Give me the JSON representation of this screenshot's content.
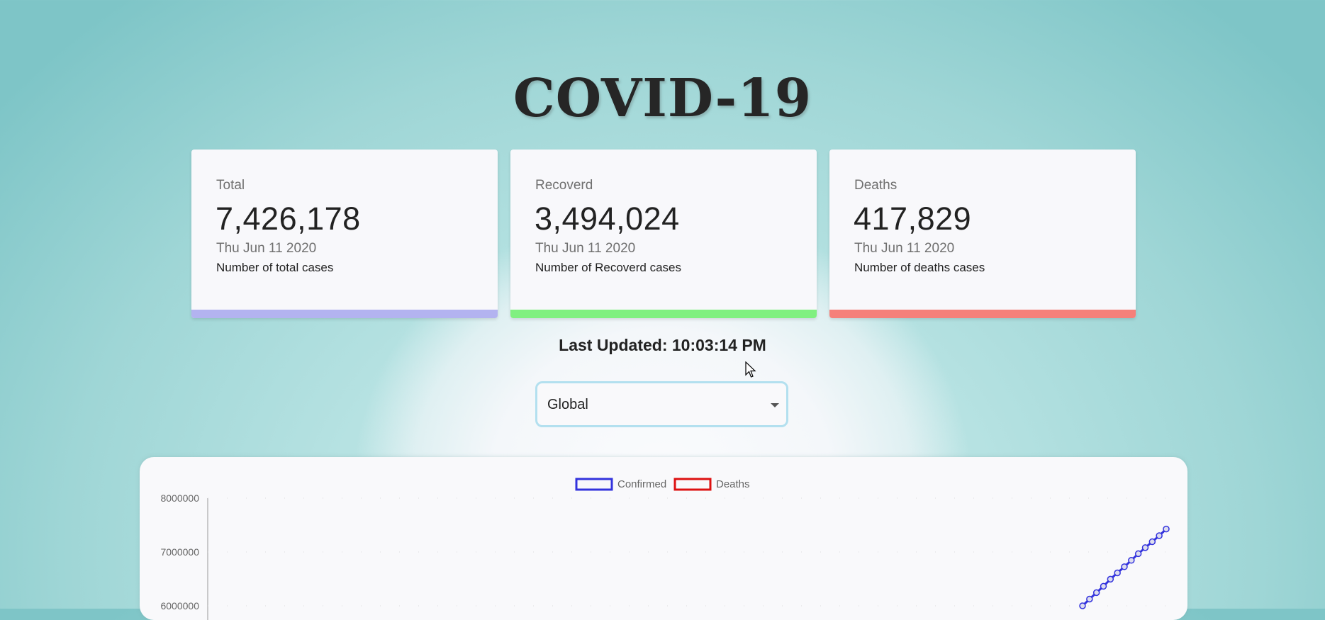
{
  "app": {
    "title": "COVID-19"
  },
  "cards": [
    {
      "label": "Total",
      "value": "7,426,178",
      "date": "Thu Jun 11 2020",
      "desc": "Number of total cases",
      "color": "#b3b3f0"
    },
    {
      "label": "Recoverd",
      "value": "3,494,024",
      "date": "Thu Jun 11 2020",
      "desc": "Number of Recoverd cases",
      "color": "#80f080"
    },
    {
      "label": "Deaths",
      "value": "417,829",
      "date": "Thu Jun 11 2020",
      "desc": "Number of deaths cases",
      "color": "#f5807a"
    }
  ],
  "last_updated": "Last Updated: 10:03:14 PM",
  "country_select": {
    "value": "Global"
  },
  "chart_data": {
    "type": "line",
    "legend": [
      {
        "name": "Confirmed",
        "color": "#3333dd"
      },
      {
        "name": "Deaths",
        "color": "#dd1111"
      }
    ],
    "y_ticks": [
      "8000000",
      "7000000",
      "6000000"
    ],
    "ylim": [
      6000000,
      8000000
    ],
    "series": [
      {
        "name": "Confirmed",
        "color": "#3333dd",
        "values": [
          6000000,
          6125000,
          6245000,
          6363000,
          6495000,
          6612000,
          6726000,
          6845000,
          6968000,
          7081000,
          7190000,
          7303000,
          7426178
        ]
      }
    ]
  }
}
